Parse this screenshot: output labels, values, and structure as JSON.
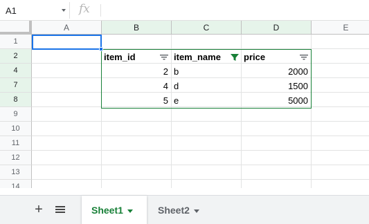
{
  "formula_bar": {
    "name_box": "A1",
    "fx_label": "fx",
    "formula": ""
  },
  "columns": [
    "A",
    "B",
    "C",
    "D",
    "E"
  ],
  "selected_columns": [
    "B",
    "C",
    "D"
  ],
  "rows": [
    "1",
    "2",
    "4",
    "7",
    "8",
    "9",
    "10",
    "11",
    "12",
    "13",
    "14"
  ],
  "selected_rows": [
    "2",
    "4",
    "7",
    "8"
  ],
  "table": {
    "headers": [
      "item_id",
      "item_name",
      "price"
    ],
    "filtered_column": "item_name",
    "data": [
      {
        "item_id": "2",
        "item_name": "b",
        "price": "2000"
      },
      {
        "item_id": "4",
        "item_name": "d",
        "price": "1500"
      },
      {
        "item_id": "5",
        "item_name": "e",
        "price": "5000"
      }
    ]
  },
  "sheets": {
    "add_icon": "plus-icon",
    "all_sheets_icon": "menu-icon",
    "tabs": [
      {
        "label": "Sheet1",
        "active": true
      },
      {
        "label": "Sheet2",
        "active": false
      }
    ]
  },
  "colors": {
    "accent_green": "#188038",
    "selection_blue": "#1a73e8",
    "header_highlight": "#e6f4ea"
  }
}
